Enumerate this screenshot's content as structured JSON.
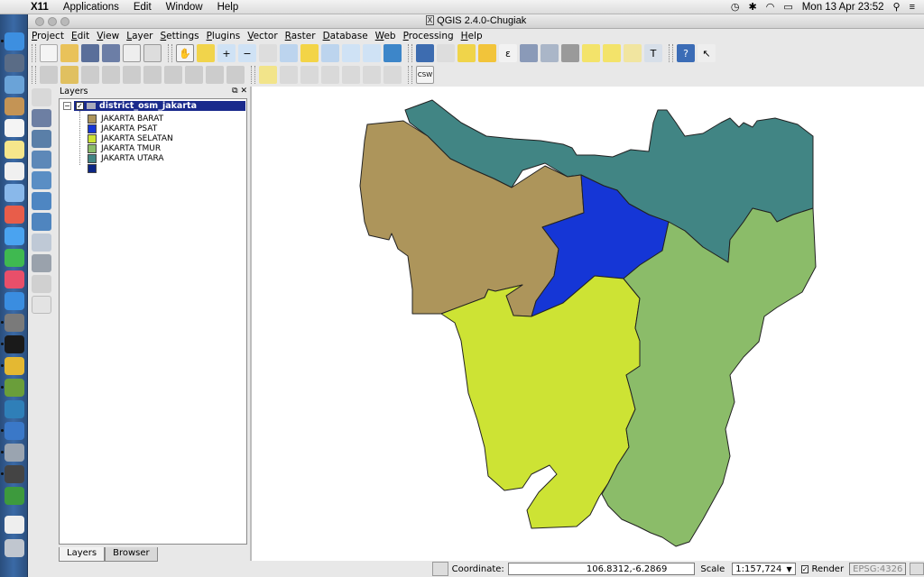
{
  "mac_menubar": {
    "app_name": "X11",
    "items": [
      "Applications",
      "Edit",
      "Window",
      "Help"
    ],
    "clock": "Mon 13 Apr  23:52"
  },
  "window": {
    "title": "QGIS 2.4.0-Chugiak"
  },
  "menu": [
    "Project",
    "Edit",
    "View",
    "Layer",
    "Settings",
    "Plugins",
    "Vector",
    "Raster",
    "Database",
    "Web",
    "Processing",
    "Help"
  ],
  "toolbar2": {
    "csw_label": "CSW"
  },
  "layers_panel": {
    "title": "Layers",
    "root_layer": "district_osm_jakarta",
    "root_checked": true,
    "legend": [
      {
        "label": "JAKARTA BARAT",
        "color": "#ad955b"
      },
      {
        "label": "JAKARTA PSAT",
        "color": "#1536d6"
      },
      {
        "label": "JAKARTA SELATAN",
        "color": "#cde334"
      },
      {
        "label": "JAKARTA TMUR",
        "color": "#8bbc69"
      },
      {
        "label": "JAKARTA UTARA",
        "color": "#418584"
      },
      {
        "label": "",
        "color": "#0b2585"
      }
    ],
    "tabs": [
      "Layers",
      "Browser"
    ]
  },
  "map": {
    "regions": [
      {
        "name": "JAKARTA BARAT",
        "color": "#ad955b"
      },
      {
        "name": "JAKARTA PSAT",
        "color": "#1536d6"
      },
      {
        "name": "JAKARTA SELATAN",
        "color": "#cde334"
      },
      {
        "name": "JAKARTA TMUR",
        "color": "#8bbc69"
      },
      {
        "name": "JAKARTA UTARA",
        "color": "#418584"
      }
    ]
  },
  "status": {
    "coordinate_label": "Coordinate:",
    "coordinate_value": "106.8312,-6.2869",
    "scale_label": "Scale",
    "scale_value": "1:157,724",
    "render_label": "Render",
    "render_checked": true,
    "crs": "EPSG:4326"
  }
}
